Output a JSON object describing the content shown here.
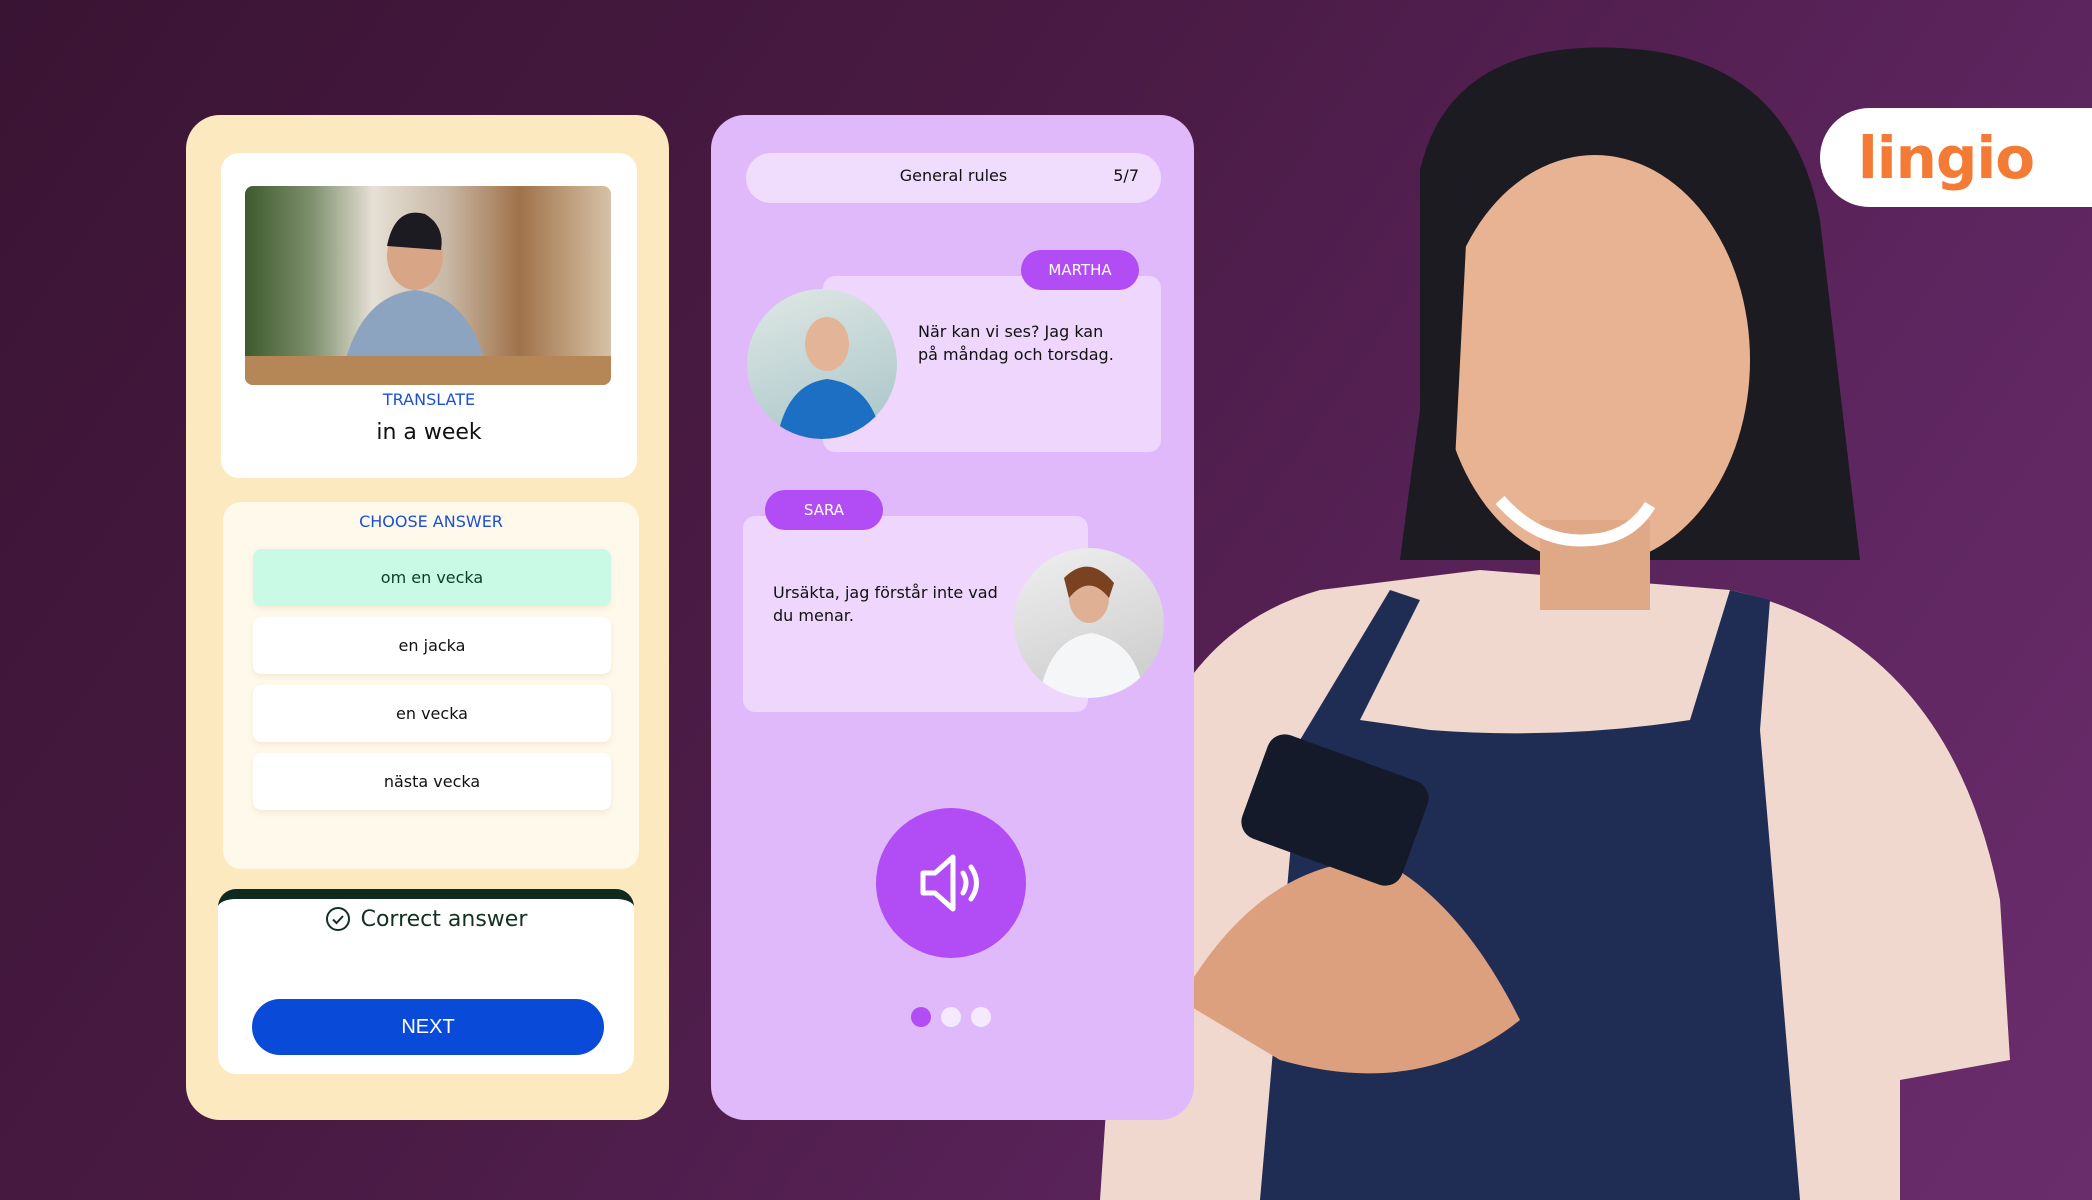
{
  "brand": {
    "logo_text": "lingio",
    "color": "#f47b35"
  },
  "quiz_card": {
    "instruction": "TRANSLATE",
    "phrase": "in a week",
    "choose_label": "CHOOSE ANSWER",
    "options": [
      {
        "label": "om en vecka",
        "selected": true
      },
      {
        "label": "en jacka",
        "selected": false
      },
      {
        "label": "en vecka",
        "selected": false
      },
      {
        "label": "nästa vecka",
        "selected": false
      }
    ],
    "feedback": "Correct answer",
    "next_label": "NEXT"
  },
  "dialogue_card": {
    "header_title": "General rules",
    "progress": "5/7",
    "messages": [
      {
        "speaker": "MARTHA",
        "text": "När kan vi ses? Jag kan på måndag och torsdag."
      },
      {
        "speaker": "SARA",
        "text": "Ursäkta, jag förstår inte vad du menar."
      }
    ],
    "page_dots": {
      "count": 3,
      "active": 1
    }
  },
  "colors": {
    "accent_purple": "#b24cf5",
    "button_blue": "#0a4ad8",
    "correct_green": "#c8fae6"
  }
}
